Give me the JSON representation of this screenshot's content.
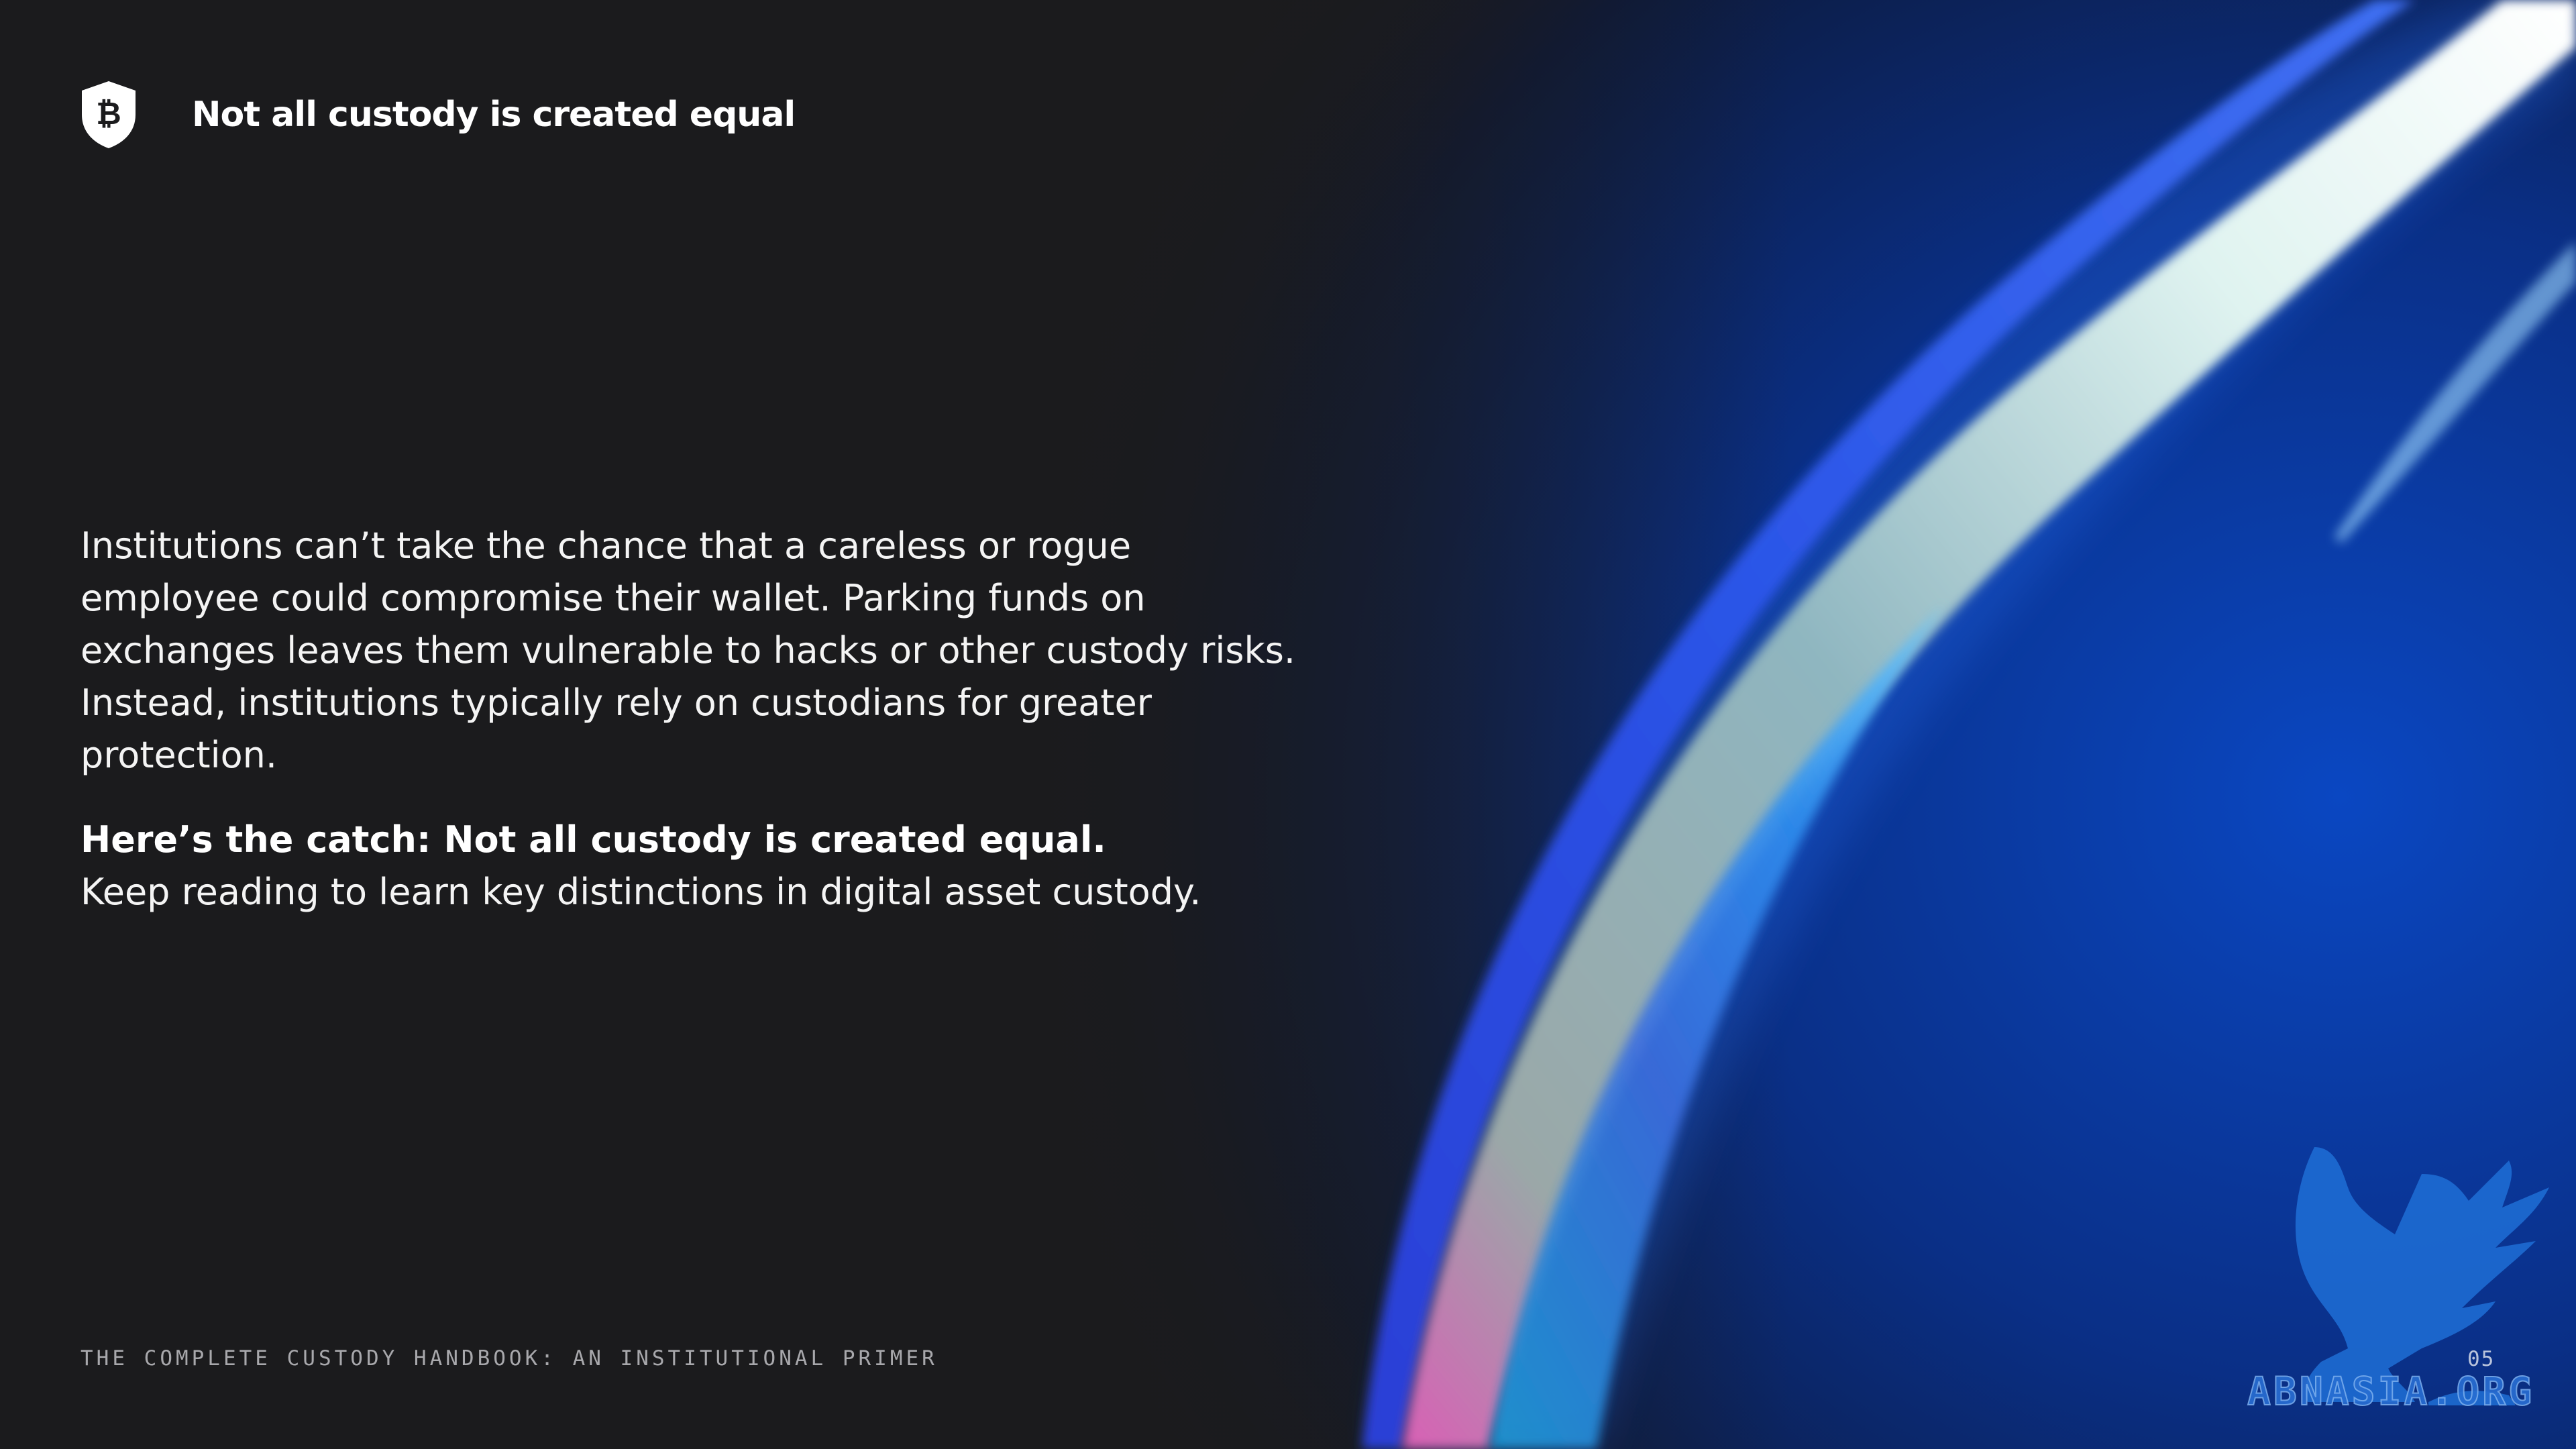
{
  "header": {
    "logo_icon": "shield-bitcoin-icon",
    "title": "Not all custody is created equal"
  },
  "body": {
    "paragraph1": "Institutions can’t take the chance that a careless or rogue employee could compromise their wallet. Parking funds on exchanges leaves them vulnerable to hacks or other custody risks. Instead, institutions typically rely on custodians for greater protection.",
    "catch_line": "Here’s the catch: Not all custody is created equal.",
    "closing_line": "Keep reading to learn key distinctions in digital asset custody."
  },
  "footer": {
    "publication": "THE COMPLETE CUSTODY HANDBOOK: AN INSTITUTIONAL PRIMER",
    "page_number": "05"
  },
  "watermark": {
    "icon": "griffin-icon",
    "text": "ABNASIA.ORG"
  },
  "colors": {
    "background": "#1b1b1d",
    "accent_blue": "#0a3fa8",
    "text": "#ffffff",
    "muted_text": "#a8a8ac"
  }
}
